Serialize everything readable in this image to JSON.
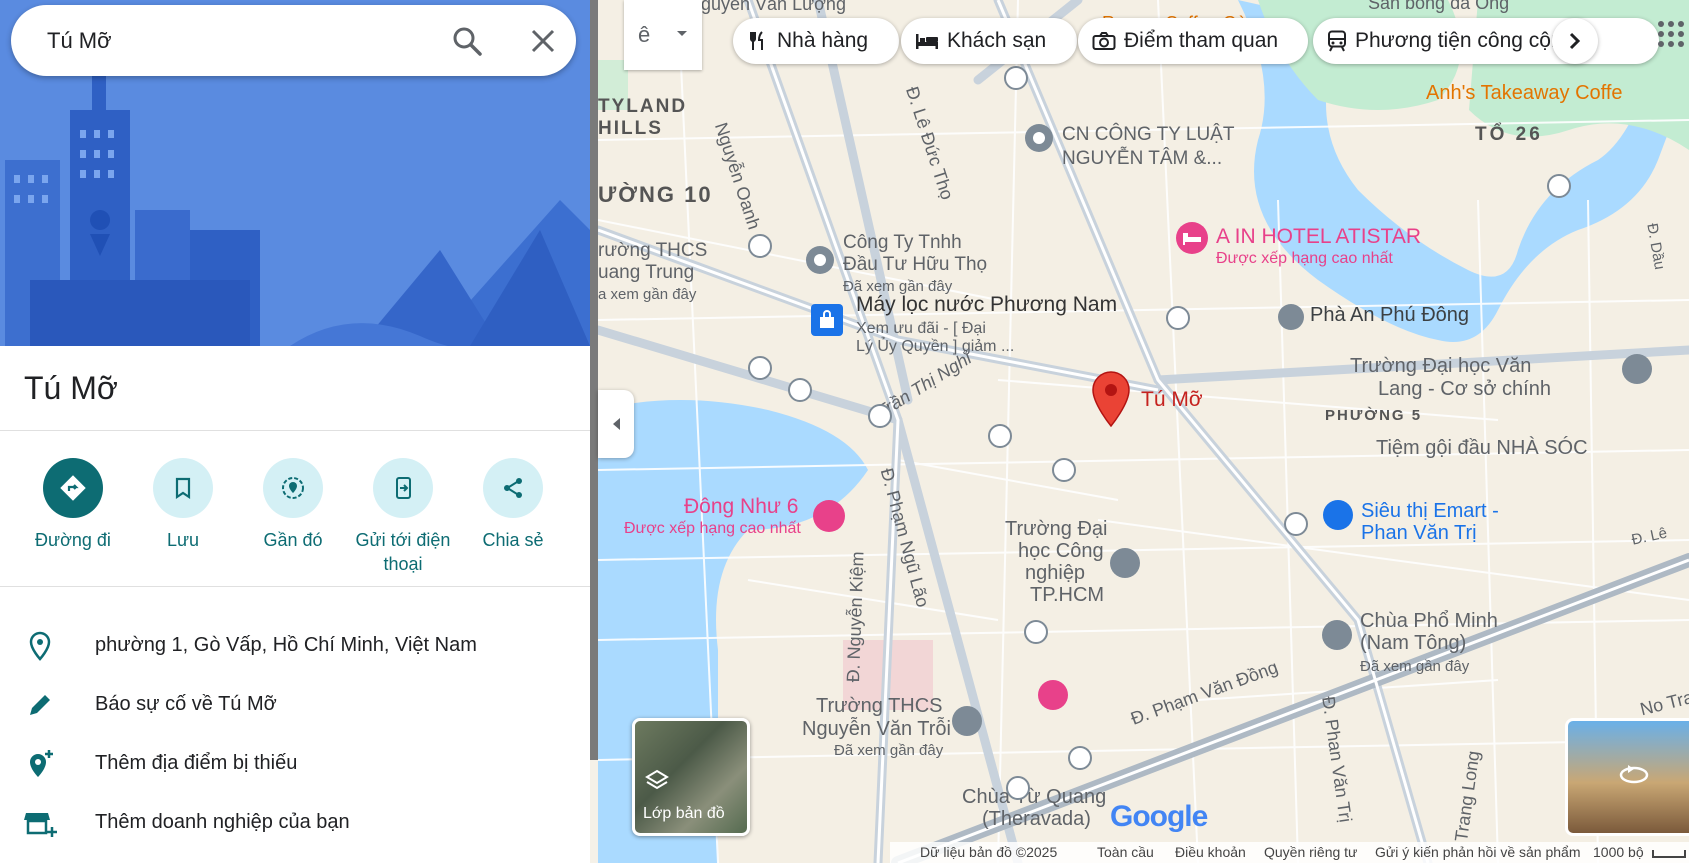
{
  "search": {
    "query": "Tú Mỡ"
  },
  "place": {
    "title": "Tú Mỡ"
  },
  "actions": [
    {
      "label": "Đường đi"
    },
    {
      "label": "Lưu"
    },
    {
      "label": "Gần đó"
    },
    {
      "label": "Gửi tới điện thoại"
    },
    {
      "label": "Chia sẻ"
    }
  ],
  "info": [
    {
      "text": "phường 1, Gò Vấp, Hồ Chí Minh, Việt Nam"
    },
    {
      "text": "Báo sự cố về Tú Mỡ"
    },
    {
      "text": "Thêm địa điểm bị thiếu"
    },
    {
      "text": "Thêm doanh nghiệp của bạn"
    }
  ],
  "chips": [
    {
      "label": "Nhà hàng"
    },
    {
      "label": "Khách sạn"
    },
    {
      "label": "Điểm tham quan"
    },
    {
      "label": "Phương tiện công cộng"
    }
  ],
  "map": {
    "areas": [
      "TYLAND",
      "HILLS",
      "ƯỜNG 10",
      "TỔ 26",
      "PHƯỜNG 5"
    ],
    "streets": [
      "Nguyễn Oanh",
      "Đ. Lê Đức Thọ",
      "Trần Thị Nghỉ",
      "Đ. Phạm Ngũ Lão",
      "Đ. Nguyễn Kiệm",
      "Đ. Phạm Văn Đồng",
      "Đ. Phan Văn Trị",
      "Nguyễn Văn Lượng",
      "Trang Long",
      "Đ. Dầu",
      "Đ. Lê",
      "No Trang"
    ],
    "pois": {
      "cong_ty_luat_1": "CN CÔNG TY LUẬT",
      "cong_ty_luat_2": "NGUYỄN TÂM &...",
      "huu_tho_1": "Công Ty Tnhh",
      "huu_tho_2": "Đầu Tư Hữu Thọ",
      "huu_tho_3": "Đã xem gần đây",
      "may_loc_1": "Máy lọc nước Phương Nam",
      "may_loc_2": "Xem ưu đãi - [ Đại",
      "may_loc_3": "Lý Ủy Quyền ] giảm ...",
      "hotel_atistar_1": "A IN HOTEL ATISTAR",
      "hotel_atistar_2": "Được xếp hạng cao nhất",
      "pha_an": "Phà An Phú Đông",
      "van_lang_1": "Trường Đại học Văn",
      "van_lang_2": "Lang - Cơ sở chính",
      "tiem_goi": "Tiệm gội đầu NHÀ SÓC",
      "tu_mo": "Tú Mỡ",
      "thcs_1": "rường THCS",
      "thcs_2": "uang Trung",
      "thcs_3": "a xem gần đây",
      "dong_nhu_1": "Đông Như 6",
      "dong_nhu_2": "Được xếp hạng cao nhất",
      "dh_cn_1": "Trường Đại",
      "dh_cn_2": "học Công",
      "dh_cn_3": "nghiệp",
      "dh_cn_4": "TP.HCM",
      "emart_1": "Siêu thị Emart -",
      "emart_2": "Phan Văn Trị",
      "chua_pho_minh_1": "Chùa Phổ Minh",
      "chua_pho_minh_2": "(Nam Tông)",
      "chua_pho_minh_3": "Đã xem gần đây",
      "thcs_nvt_1": "Trường THCS",
      "thcs_nvt_2": "Nguyễn Văn Trỗi",
      "thcs_nvt_3": "Đã xem gần đây",
      "chua_tu_quang_1": "Chùa Từ Quang",
      "chua_tu_quang_2": "(Theravada)",
      "anh_takeaway": "Anh's Takeaway Coffe",
      "san_bong": "Sân bóng đá Ông",
      "romeo": "Romeo Coffee Gò"
    },
    "layers_label": "Lớp bản đồ",
    "google": "Google"
  },
  "footer": {
    "data": "Dữ liệu bản đồ ©2025",
    "global": "Toàn cầu",
    "terms": "Điều khoản",
    "privacy": "Quyền riêng tư",
    "feedback": "Gửi ý kiến phản hồi về sản phẩm",
    "scale": "1000 bộ"
  },
  "colors": {
    "accent": "#0d6c73",
    "accent_light": "#d4f0f5",
    "hotel_pink": "#e8418a",
    "pin_red": "#ea4335",
    "water": "#aadaff",
    "park": "#c3ecd2"
  }
}
